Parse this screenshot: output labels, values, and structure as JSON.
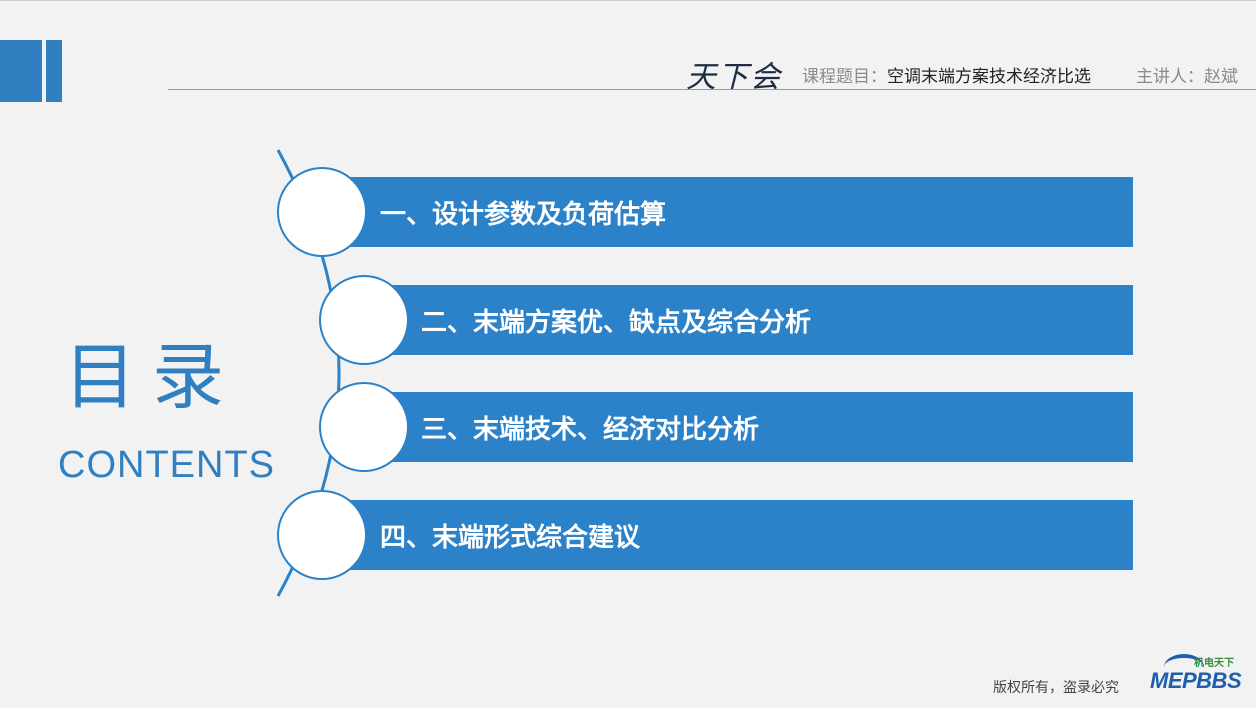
{
  "header": {
    "logo_text": "天下会",
    "course_label": "课程题目：",
    "course_title": "空调末端方案技术经济比选",
    "presenter_label": "主讲人：",
    "presenter_name": "赵斌"
  },
  "title": {
    "chinese": "目录",
    "english": "CONTENTS"
  },
  "items": [
    {
      "label": "一、设计参数及负荷估算"
    },
    {
      "label": "二、末端方案优、缺点及综合分析"
    },
    {
      "label": "三、末端技术、经济对比分析"
    },
    {
      "label": "四、末端形式综合建议"
    }
  ],
  "footer": {
    "copyright": "版权所有，盗录必究",
    "brand": "MEPBBS",
    "brand_sub": "机电天下"
  },
  "colors": {
    "accent": "#2b82c8",
    "background": "#f2f2f2"
  }
}
